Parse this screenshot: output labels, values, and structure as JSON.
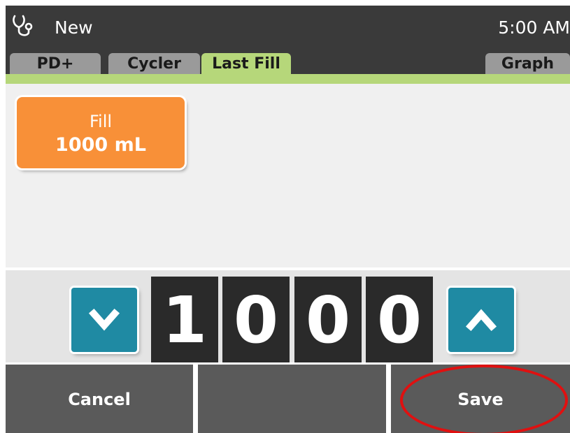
{
  "header": {
    "title": "New",
    "time": "5:00 AM",
    "app_icon": "stethoscope-icon"
  },
  "tabs": [
    {
      "label": "PD+",
      "active": false
    },
    {
      "label": "Cycler",
      "active": false
    },
    {
      "label": "Last Fill",
      "active": true
    },
    {
      "label": "Graph",
      "active": false
    }
  ],
  "phase": {
    "name": "Fill",
    "value": "1000 mL",
    "color": "#f89038"
  },
  "stepper": {
    "digits": [
      "1",
      "0",
      "0",
      "0"
    ],
    "decrease_icon": "chevron-down-icon",
    "increase_icon": "chevron-up-icon",
    "button_color": "#1f8aa3"
  },
  "actions": {
    "cancel_label": "Cancel",
    "middle_label": "",
    "save_label": "Save"
  },
  "colors": {
    "accent": "#b6d77a",
    "header_bg": "#3a3a3a",
    "highlight": "#e01010"
  }
}
